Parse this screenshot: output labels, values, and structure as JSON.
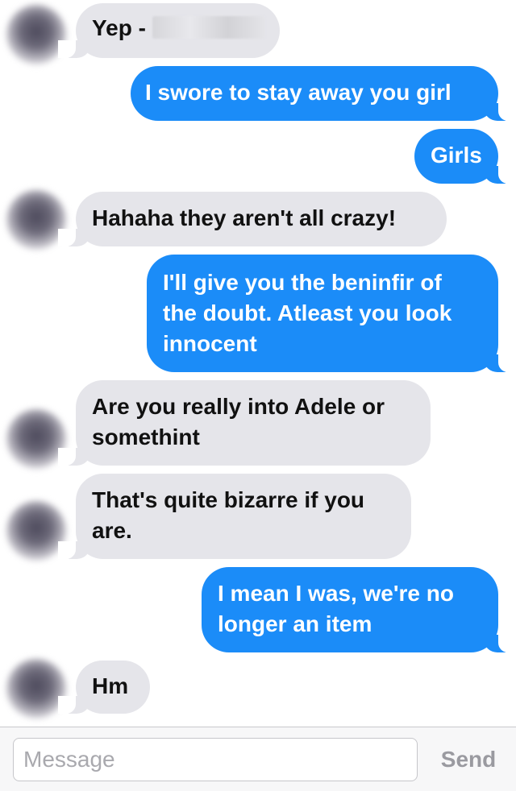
{
  "messages": [
    {
      "direction": "in",
      "text": "Yep -",
      "redacted": true
    },
    {
      "direction": "out",
      "text": "I swore to stay away you girl"
    },
    {
      "direction": "out",
      "text": "Girls"
    },
    {
      "direction": "in",
      "text": "Hahaha they aren't all crazy!"
    },
    {
      "direction": "out",
      "lines": [
        "I'll give you the beninfir of",
        "the doubt. Atleast you look",
        "innocent"
      ]
    },
    {
      "direction": "in",
      "lines": [
        "Are you really into Adele or",
        "somethint"
      ]
    },
    {
      "direction": "in",
      "lines": [
        "That's quite bizarre if you",
        "are."
      ]
    },
    {
      "direction": "out",
      "lines": [
        "I mean I was, we're no",
        "longer an item"
      ]
    },
    {
      "direction": "in",
      "text": "Hm"
    }
  ],
  "input_bar": {
    "placeholder": "Message",
    "value": "",
    "send_label": "Send"
  }
}
